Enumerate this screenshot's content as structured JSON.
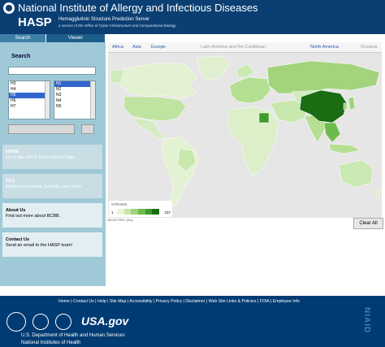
{
  "header": {
    "institute": "National Institute of Allergy and Infectious Diseases",
    "app_name": "HASP",
    "subtitle": "Hemagglutinin Structure Prediction Server",
    "tagline": "a service of the Office of Cyber Infrastructure and Computational Biology"
  },
  "tabs": [
    {
      "label": "Search"
    },
    {
      "label": "Viewer"
    }
  ],
  "search": {
    "label": "Search",
    "value": ""
  },
  "lists": {
    "h_list": [
      "H3",
      "H4",
      "H5",
      "H6",
      "H7"
    ],
    "h_selected": "H5",
    "n_list": [
      "N1",
      "N2",
      "N3",
      "N4",
      "N5"
    ],
    "n_selected": "N1"
  },
  "sidebar_cards": [
    {
      "title": "HOME",
      "desc": "Go to the HASP Entry Home Page."
    },
    {
      "title": "FAQ",
      "desc": "Explore overviews, tutorials, and more."
    },
    {
      "title": "About Us",
      "desc": "Find out more about BCBB."
    },
    {
      "title": "Contact Us",
      "desc": "Send an email to the HASP team!"
    }
  ],
  "regions": [
    "Africa",
    "Asia",
    "Europe",
    "Latin America and the Caribbean",
    "North America",
    "Oceania"
  ],
  "legend": {
    "title": "STRAINS",
    "min": "1",
    "max": "237",
    "colors": [
      "#e8f5d8",
      "#c6e7a8",
      "#9fd47a",
      "#6fba4c",
      "#3e9a2a",
      "#1b6d14"
    ]
  },
  "selected_label": "SELECTED: (0/n)",
  "clear_all_label": "Clear All",
  "footer": {
    "links": "Home | Contact Us | Help | Site Map | Accessibility | Privacy Policy | Disclaimer | Web Site Links & Policies | FOIA | Employee Info",
    "dept1": "U.S. Department of Health and Human Services",
    "dept2": "National Institutes of Health",
    "usagov": "USA.gov",
    "niaid": "NIAID"
  }
}
